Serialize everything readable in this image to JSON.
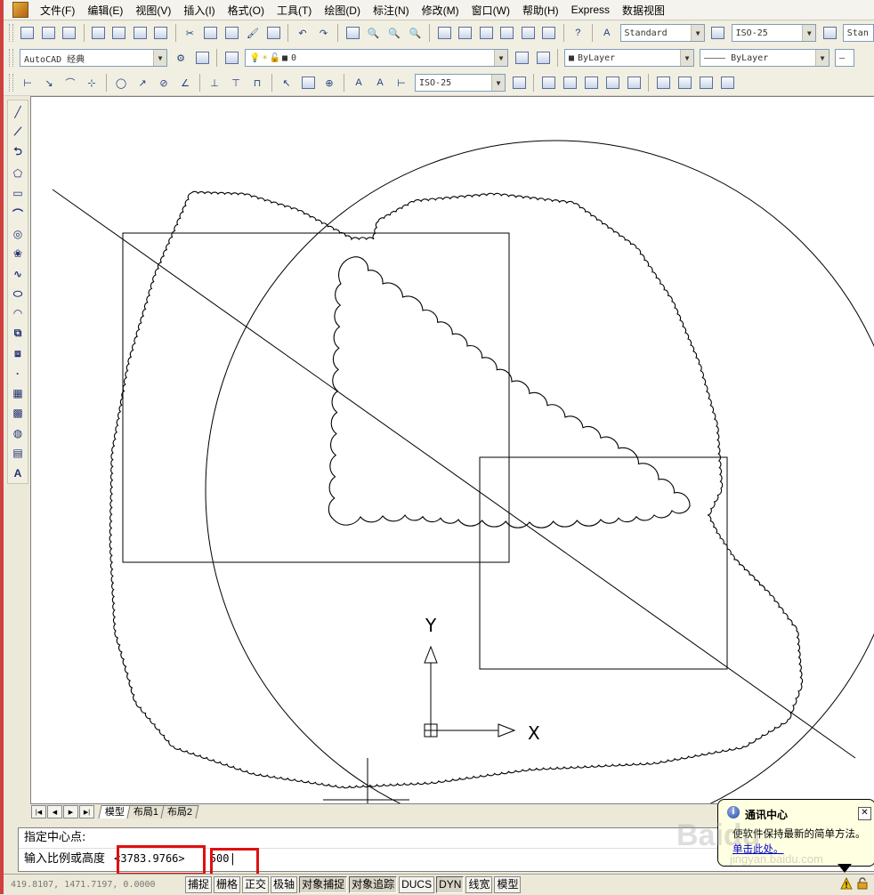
{
  "menu": {
    "items": [
      "文件(F)",
      "编辑(E)",
      "视图(V)",
      "插入(I)",
      "格式(O)",
      "工具(T)",
      "绘图(D)",
      "标注(N)",
      "修改(M)",
      "窗口(W)",
      "帮助(H)",
      "Express",
      "数据视图"
    ]
  },
  "toolbar": {
    "text_style": "Standard",
    "dim_style": "ISO-25",
    "table_style": "Stan",
    "workspace": "AutoCAD 经典",
    "layer": "0",
    "color": "ByLayer",
    "linetype": "ByLayer",
    "dim_style_2": "ISO-25"
  },
  "canvas": {
    "ucs_y": "Y",
    "ucs_x": "X"
  },
  "tabs": [
    "模型",
    "布局1",
    "布局2"
  ],
  "command": {
    "line1": "指定中心点:",
    "line2_prompt": "输入比例或高度",
    "line2_default": "<3783.9766>",
    "line2_input": "500"
  },
  "status": {
    "coords": "419.8107,   1471.7197,  0.0000",
    "buttons": [
      "捕捉",
      "栅格",
      "正交",
      "极轴",
      "对象捕捉",
      "对象追踪",
      "DUCS",
      "DYN",
      "线宽",
      "模型"
    ]
  },
  "balloon": {
    "title": "通讯中心",
    "body": "使软件保持最新的简单方法。",
    "link": "单击此处。"
  },
  "watermark": {
    "main": "Baidu",
    "sub": "jingyan.baidu.com"
  },
  "colors": {
    "highlight": "#e01010",
    "canvas": "#ffffff",
    "chrome": "#ece9d8"
  }
}
